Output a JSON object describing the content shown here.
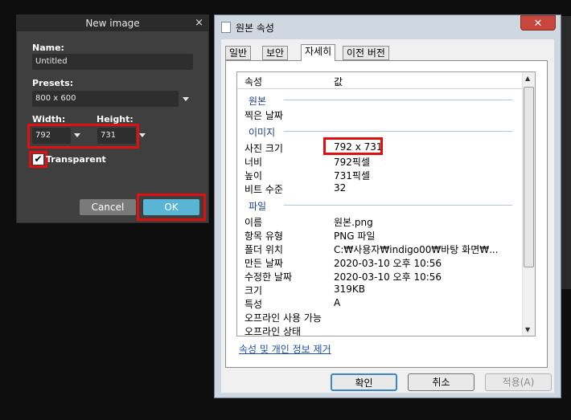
{
  "new_image": {
    "title": "New image",
    "close": "×",
    "name_label": "Name:",
    "name_value": "Untitled",
    "presets_label": "Presets:",
    "presets_value": "800 x 600",
    "width_label": "Width:",
    "width_value": "792",
    "height_label": "Height:",
    "height_value": "731",
    "transparent_label": "Transparent",
    "transparent_checked": true,
    "check_glyph": "✔",
    "cancel_label": "Cancel",
    "ok_label": "OK"
  },
  "props": {
    "title": "원본 속성",
    "close": "✕",
    "tabs": [
      "일반",
      "보안",
      "자세히",
      "이전 버전"
    ],
    "active_tab": "자세히",
    "col_property": "속성",
    "col_value": "값",
    "sections": {
      "origin": "원본",
      "image": "이미지",
      "file": "파일"
    },
    "rows": {
      "taken_date": "찍은 날짜",
      "dimensions_key": "사진 크기",
      "dimensions_val": "792 x 731",
      "width_key": "너비",
      "width_val": "792픽셀",
      "height_key": "높이",
      "height_val": "731픽셀",
      "bitdepth_key": "비트 수준",
      "bitdepth_val": "32",
      "name_key": "이름",
      "name_val": "원본.png",
      "type_key": "항목 유형",
      "type_val": "PNG 파일",
      "folder_key": "폴더 위치",
      "folder_val": "C:₩사용자₩indigo00₩바탕 화면₩...",
      "created_key": "만든 날짜",
      "created_val": "2020-03-10 오후 10:56",
      "modified_key": "수정한 날짜",
      "modified_val": "2020-03-10 오후 10:56",
      "size_key": "크기",
      "size_val": "319KB",
      "attr_key": "특성",
      "attr_val": "A",
      "offline_avail_key": "오프라인 사용 가능",
      "offline_status_key": "오프라인 상태"
    },
    "remove_link": "속성 및 개인 정보 제거",
    "ok_label": "확인",
    "cancel_label": "취소",
    "apply_label": "적용(A)"
  },
  "colors": {
    "highlight": "#e01010",
    "ok_button": "#5ab4d4",
    "section_text": "#1e3c8c"
  }
}
